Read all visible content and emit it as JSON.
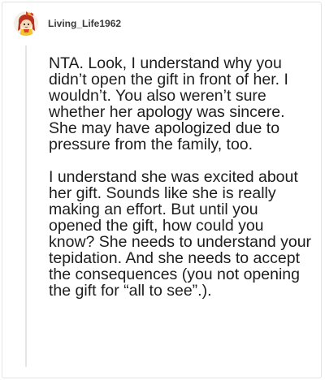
{
  "comment": {
    "username": "Living_Life1962",
    "avatar_icon": "cartoon-character-avatar-icon",
    "paragraphs": [
      "NTA. Look, I understand why you didn’t open the gift in front of her. I wouldn’t. You also weren’t sure whether her apology was sincere. She may have apologized due to pressure from the family, too.",
      "I understand she was excited about her gift. Sounds like she is really making an effort. But until you opened the gift, how could you know? She needs to understand your tepidation. And she needs to accept the consequences (you not opening the gift for “all to see”.)."
    ]
  },
  "colors": {
    "username": "#3a3a3a",
    "text": "#1d1d1d",
    "border": "#e3e3e3",
    "thread_line": "#e6e6e6",
    "avatar_bg": "#f3efe6"
  }
}
